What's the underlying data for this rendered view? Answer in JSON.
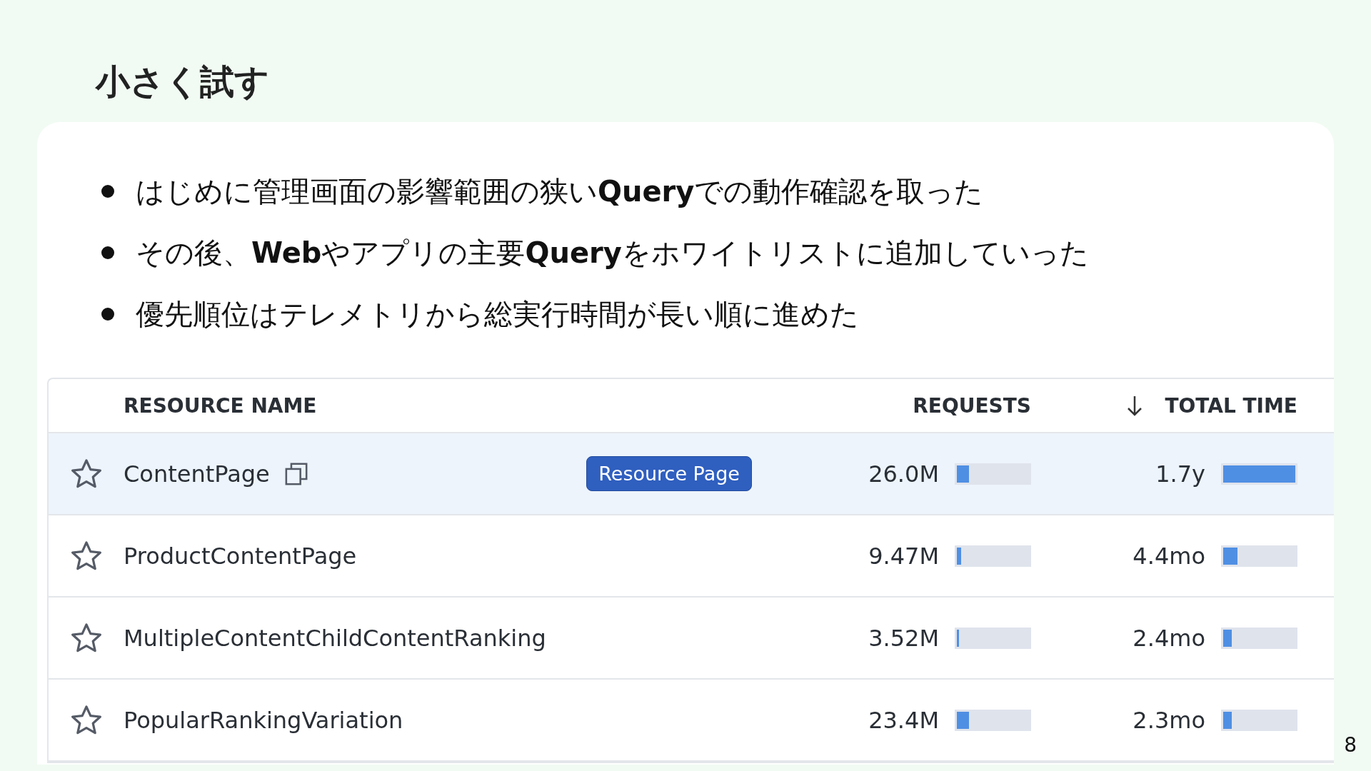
{
  "slide": {
    "title": "小さく試す",
    "page_number": "8"
  },
  "bullets": [
    "はじめに管理画面の影響範囲の狭い**Query**での動作確認を取った",
    "その後、**Web**やアプリの主要**Query**をホワイトリストに追加していった",
    "優先順位はテレメトリから総実行時間が長い順に進めた"
  ],
  "table": {
    "columns": [
      {
        "label": "RESOURCE NAME",
        "sorted": false
      },
      {
        "label": "REQUESTS",
        "sorted": false
      },
      {
        "label": "TOTAL TIME",
        "sorted": true
      }
    ],
    "rows": [
      {
        "name": "ContentPage",
        "selected": true,
        "button": "Resource Page",
        "requests": {
          "text": "26.0M",
          "level": 0.17
        },
        "total_time": {
          "text": "1.7y",
          "level": 1.0
        }
      },
      {
        "name": "ProductContentPage",
        "selected": false,
        "requests": {
          "text": "9.47M",
          "level": 0.06
        },
        "total_time": {
          "text": "4.4mo",
          "level": 0.2
        }
      },
      {
        "name": "MultipleContentChildContentRanking",
        "selected": false,
        "requests": {
          "text": "3.52M",
          "level": 0.03
        },
        "total_time": {
          "text": "2.4mo",
          "level": 0.12
        }
      },
      {
        "name": "PopularRankingVariation",
        "selected": false,
        "requests": {
          "text": "23.4M",
          "level": 0.17
        },
        "total_time": {
          "text": "2.3mo",
          "level": 0.12
        }
      }
    ]
  }
}
